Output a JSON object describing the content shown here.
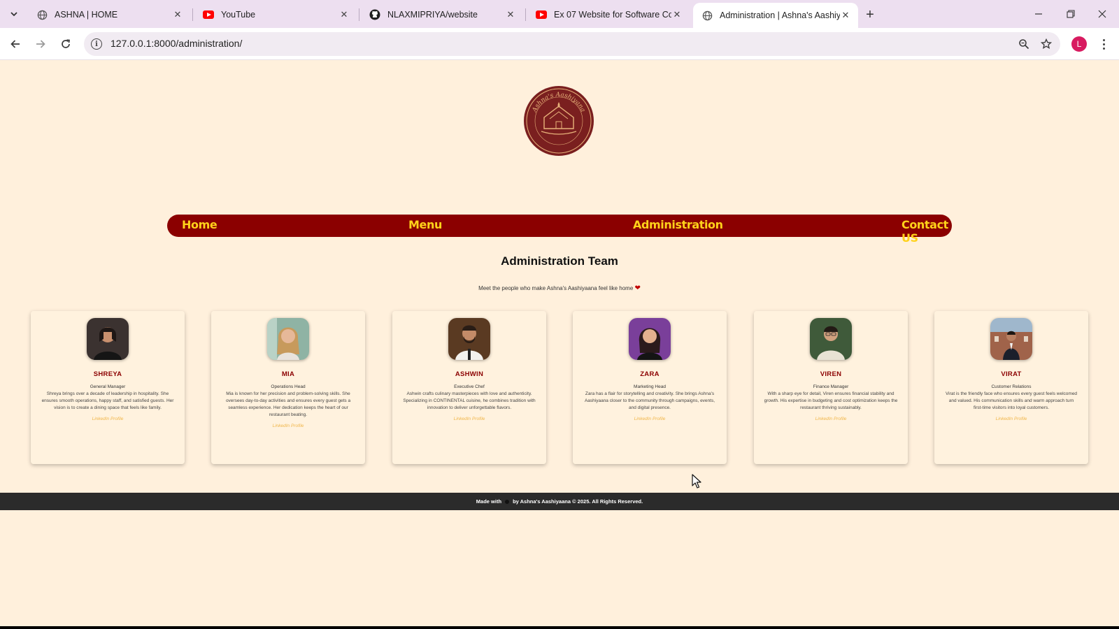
{
  "browser": {
    "tabs": [
      {
        "title": "ASHNA | HOME",
        "favicon": "globe-icon"
      },
      {
        "title": "YouTube",
        "favicon": "youtube-icon"
      },
      {
        "title": "NLAXMIPRIYA/website",
        "favicon": "github-icon"
      },
      {
        "title": "Ex 07 Website for Software Con",
        "favicon": "youtube-icon"
      },
      {
        "title": "Administration | Ashna's Aashiy",
        "favicon": "globe-icon",
        "active": true
      }
    ],
    "url": "127.0.0.1:8000/administration/",
    "profile_initial": "L"
  },
  "site": {
    "logo_text": "Ashna's Aashiyana",
    "nav": [
      "Home",
      "Menu",
      "Administration",
      "Contact US"
    ],
    "title": "Administration Team",
    "subtitle": "Meet the people who make Ashna's Aashiyaana feel like home",
    "heart": "❤",
    "link_label": "LinkedIn Profile",
    "team": [
      {
        "name": "SHREYA",
        "role": "General Manager",
        "bio": "Shreya brings over a decade of leadership in hospitality. She ensures smooth operations, happy staff, and satisfied guests. Her vision is to create a dining space that feels like family."
      },
      {
        "name": "MIA",
        "role": "Operations Head",
        "bio": "Mia is known for her precision and problem-solving skills. She oversees day-to-day activities and ensures every guest gets a seamless experience. Her dedication keeps the heart of our restaurant beating."
      },
      {
        "name": "ASHWIN",
        "role": "Executive Chef",
        "bio": "Ashwin crafts culinary masterpieces with love and authenticity. Specializing in CONTINENTAL cuisine, he combines tradition with innovation to deliver unforgettable flavors."
      },
      {
        "name": "ZARA",
        "role": "Marketing Head",
        "bio": "Zara has a flair for storytelling and creativity. She brings Ashna's Aashiyaana closer to the community through campaigns, events, and digital presence."
      },
      {
        "name": "VIREN",
        "role": "Finance Manager",
        "bio": "With a sharp eye for detail, Viren ensures financial stability and growth. His expertise in budgeting and cost optimization keeps the restaurant thriving sustainably."
      },
      {
        "name": "VIRAT",
        "role": "Customer Relations",
        "bio": "Virat is the friendly face who ensures every guest feels welcomed and valued. His communication skills and warm approach turn first-time visitors into loyal customers."
      }
    ],
    "footer_before": "Made with",
    "footer_after": "by Ashna's Aashiyaana © 2025. All Rights Reserved."
  },
  "colors": {
    "nav_bg": "#8b0000",
    "nav_text": "#ffd21a",
    "page_bg": "#fff0dc",
    "footer_bg": "#2b2b2b"
  }
}
